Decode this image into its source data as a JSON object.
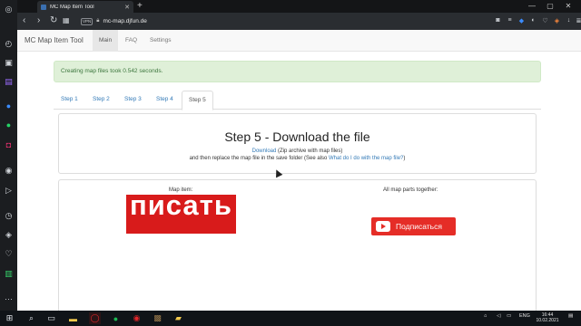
{
  "browser": {
    "tab_title": "MC Map Item Tool",
    "tab_close": "✕",
    "new_tab": "+",
    "window_controls": [
      "—",
      "▢",
      "✕"
    ],
    "url": "mc-map.djfun.de",
    "vpn_badge": "VPN",
    "nav_icons": [
      "back-icon",
      "forward-icon",
      "reload-icon",
      "speed-dial-icon"
    ],
    "extension_icons": [
      "camera-icon",
      "menu-icon",
      "shield-icon",
      "vpn-icon",
      "heart-icon",
      "cube-icon",
      "download-icon",
      "settings-icon"
    ]
  },
  "sidebar_icons": [
    "speed-dial-icon",
    "bag-icon",
    "twitch-icon",
    "messenger-icon",
    "whatsapp-icon",
    "instagram-icon",
    "music-icon",
    "send-icon",
    "history-icon",
    "cube-icon",
    "heart-icon",
    "settings-icon"
  ],
  "site": {
    "brand": "MC Map Item Tool",
    "nav": [
      "Main",
      "FAQ",
      "Settings"
    ],
    "alert": "Creating map files took 0.542 seconds.",
    "steps": [
      "Step 1",
      "Step 2",
      "Step 3",
      "Step 4",
      "Step 5"
    ],
    "heading": "Step 5 - Download the file",
    "download_link": "Download",
    "download_note": " (Zip archive with map files)",
    "replace_text": "and then replace the map file in the save folder (See also ",
    "help_link": "What do I do with the map file?",
    "replace_end": ")",
    "map_item_label": "Map item:",
    "map_parts_label": "All map parts together:",
    "map_item_image_text": "писать",
    "subscribe_label": "Подписаться"
  },
  "taskbar": {
    "apps": [
      "windows-icon",
      "search-icon",
      "task-view-icon",
      "file-explorer-icon",
      "opera-icon",
      "spotify-icon",
      "app-icon",
      "minecraft-icon",
      "folder-icon"
    ],
    "lang": "ENG",
    "time": "16:44",
    "date": "10.02.2021"
  }
}
